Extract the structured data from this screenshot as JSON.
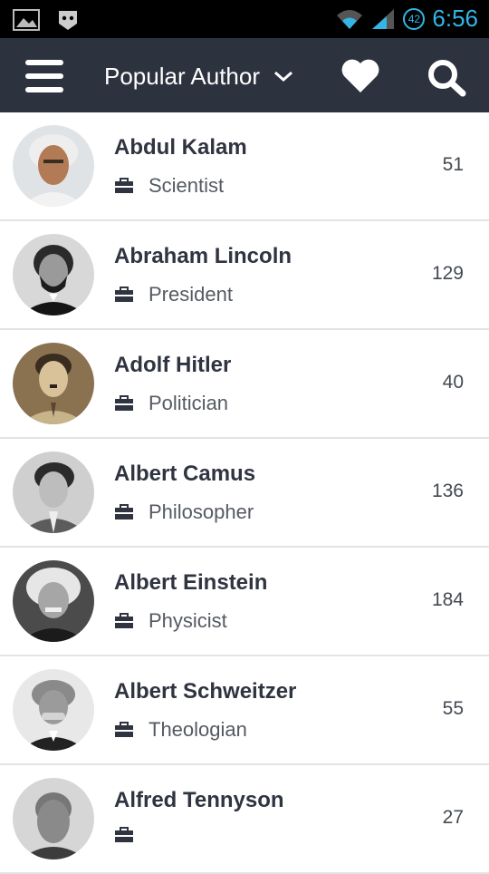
{
  "status_bar": {
    "time": "6:56",
    "badge": "42",
    "left_icons": [
      "image-icon",
      "bbm-icon"
    ],
    "right_icons": [
      "wifi-icon",
      "signal-icon"
    ]
  },
  "app_bar": {
    "title": "Popular Author",
    "icons": [
      "menu-icon",
      "chevron-down-icon",
      "heart-icon",
      "search-icon"
    ],
    "background": "#2c333f"
  },
  "authors": [
    {
      "name": "Abdul Kalam",
      "profession": "Scientist",
      "count": "51"
    },
    {
      "name": "Abraham Lincoln",
      "profession": "President",
      "count": "129"
    },
    {
      "name": "Adolf Hitler",
      "profession": "Politician",
      "count": "40"
    },
    {
      "name": "Albert Camus",
      "profession": "Philosopher",
      "count": "136"
    },
    {
      "name": "Albert Einstein",
      "profession": "Physicist",
      "count": "184"
    },
    {
      "name": "Albert Schweitzer",
      "profession": "Theologian",
      "count": "55"
    },
    {
      "name": "Alfred Tennyson",
      "profession": "",
      "count": "27"
    }
  ]
}
